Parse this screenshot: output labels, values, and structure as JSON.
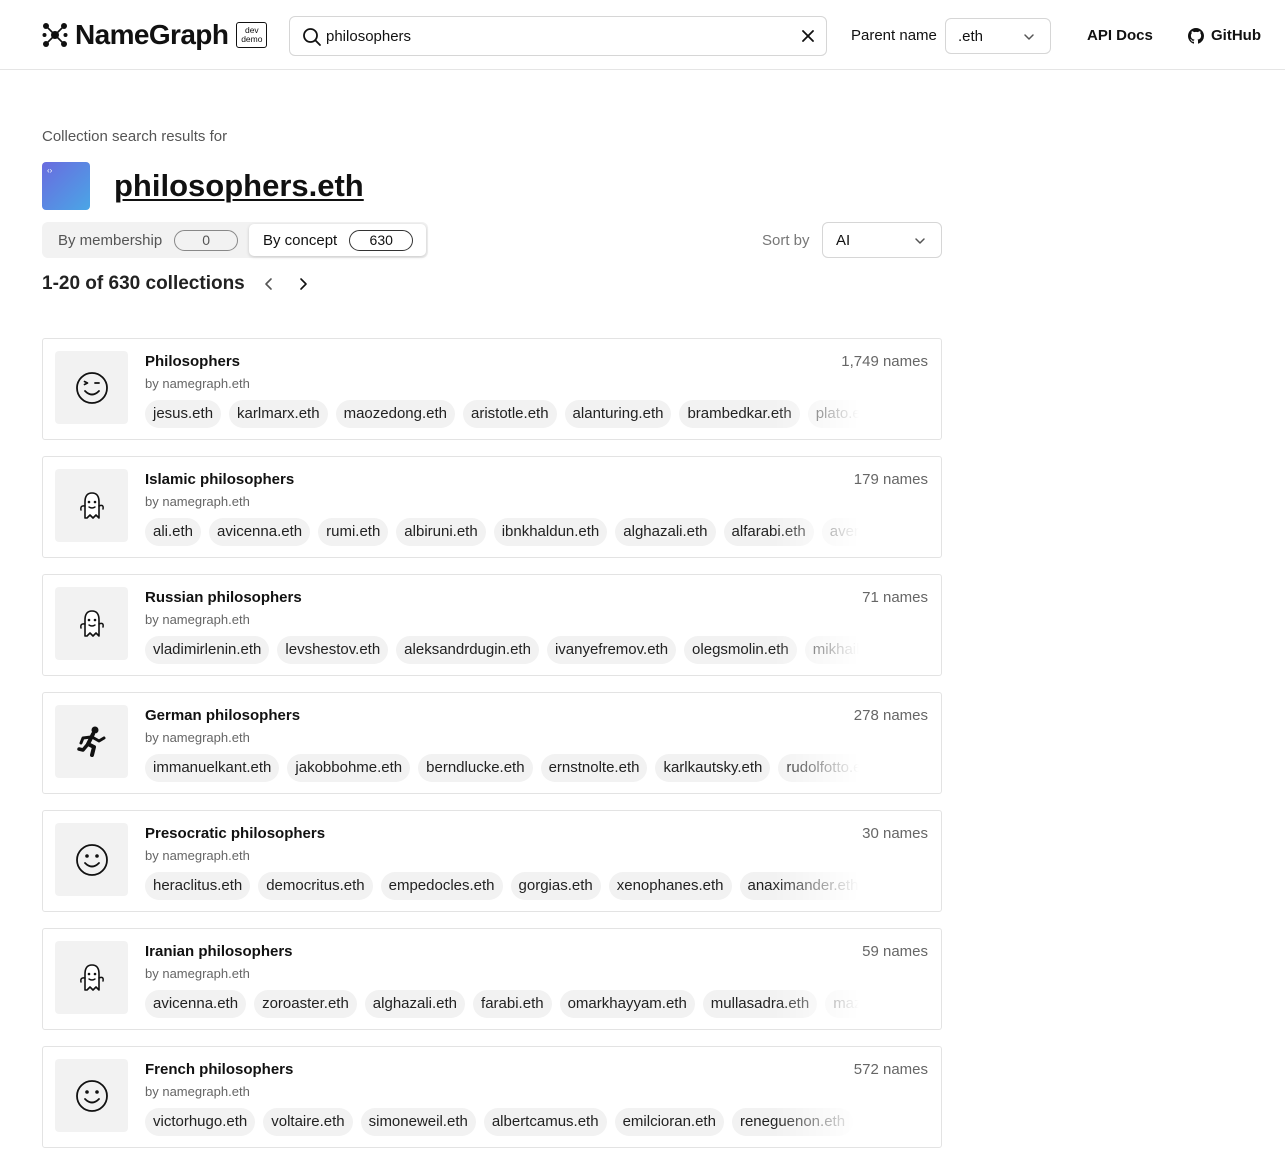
{
  "header": {
    "logo_text": "NameGraph",
    "badge_line1": "dev",
    "badge_line2": "demo",
    "search_value": "philosophers",
    "parent_label": "Parent name",
    "parent_value": ".eth",
    "api_docs": "API Docs",
    "github": "GitHub"
  },
  "results": {
    "intro": "Collection search results for",
    "query": "philosophers.eth",
    "tabs": [
      {
        "label": "By membership",
        "count": "0"
      },
      {
        "label": "By concept",
        "count": "630"
      }
    ],
    "sort_label": "Sort by",
    "sort_value": "AI",
    "range_text": "1-20 of 630 collections"
  },
  "collections": [
    {
      "title": "Philosophers",
      "by": "by namegraph.eth",
      "count": "1,749 names",
      "icon": "wink-face-icon",
      "names": [
        "jesus.eth",
        "karlmarx.eth",
        "maozedong.eth",
        "aristotle.eth",
        "alanturing.eth",
        "brambedkar.eth",
        "plato.eth"
      ]
    },
    {
      "title": "Islamic philosophers",
      "by": "by namegraph.eth",
      "count": "179 names",
      "icon": "ghost-icon",
      "names": [
        "ali.eth",
        "avicenna.eth",
        "rumi.eth",
        "albiruni.eth",
        "ibnkhaldun.eth",
        "alghazali.eth",
        "alfarabi.eth",
        "averroes.eth"
      ]
    },
    {
      "title": "Russian philosophers",
      "by": "by namegraph.eth",
      "count": "71 names",
      "icon": "ghost-icon",
      "names": [
        "vladimirlenin.eth",
        "levshestov.eth",
        "aleksandrdugin.eth",
        "ivanyefremov.eth",
        "olegsmolin.eth",
        "mikhail.eth"
      ]
    },
    {
      "title": "German philosophers",
      "by": "by namegraph.eth",
      "count": "278 names",
      "icon": "running-figure-icon",
      "names": [
        "immanuelkant.eth",
        "jakobbohme.eth",
        "berndlucke.eth",
        "ernstnolte.eth",
        "karlkautsky.eth",
        "rudolfotto.eth"
      ]
    },
    {
      "title": "Presocratic philosophers",
      "by": "by namegraph.eth",
      "count": "30 names",
      "icon": "smile-face-icon",
      "names": [
        "heraclitus.eth",
        "democritus.eth",
        "empedocles.eth",
        "gorgias.eth",
        "xenophanes.eth",
        "anaximander.eth"
      ]
    },
    {
      "title": "Iranian philosophers",
      "by": "by namegraph.eth",
      "count": "59 names",
      "icon": "ghost-icon",
      "names": [
        "avicenna.eth",
        "zoroaster.eth",
        "alghazali.eth",
        "farabi.eth",
        "omarkhayyam.eth",
        "mullasadra.eth",
        "mazdak.eth"
      ]
    },
    {
      "title": "French philosophers",
      "by": "by namegraph.eth",
      "count": "572 names",
      "icon": "smile-face-icon",
      "names": [
        "victorhugo.eth",
        "voltaire.eth",
        "simoneweil.eth",
        "albertcamus.eth",
        "emilcioran.eth",
        "reneguenon.eth"
      ]
    }
  ]
}
